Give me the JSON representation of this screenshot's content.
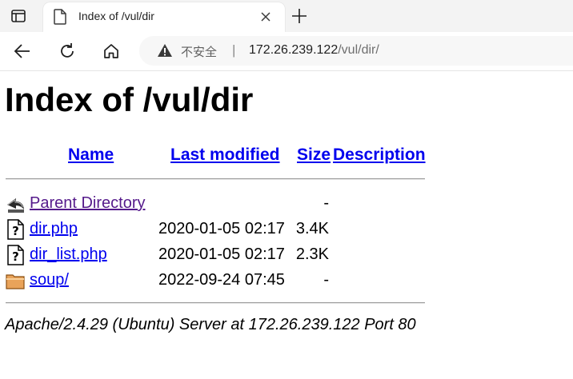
{
  "browser": {
    "tab_title": "Index of /vul/dir",
    "security_label": "不安全",
    "url_host": "172.26.239.122",
    "url_path": "/vul/dir/"
  },
  "page": {
    "heading": "Index of /vul/dir",
    "columns": [
      "Name",
      "Last modified",
      "Size",
      "Description"
    ],
    "entries": [
      {
        "icon": "back-icon",
        "name": "Parent Directory",
        "modified": "",
        "size": "-",
        "description": "",
        "visited": true
      },
      {
        "icon": "unknown-file-icon",
        "name": "dir.php",
        "modified": "2020-01-05 02:17",
        "size": "3.4K",
        "description": "",
        "visited": false
      },
      {
        "icon": "unknown-file-icon",
        "name": "dir_list.php",
        "modified": "2020-01-05 02:17",
        "size": "2.3K",
        "description": "",
        "visited": false
      },
      {
        "icon": "folder-icon",
        "name": "soup/",
        "modified": "2022-09-24 07:45",
        "size": "-",
        "description": "",
        "visited": false
      }
    ],
    "footer": "Apache/2.4.29 (Ubuntu) Server at 172.26.239.122 Port 80"
  },
  "colors": {
    "link": "#0000ee",
    "visited_link": "#551a8b",
    "chrome_bg": "#f3f3f3",
    "address_bg": "#f7f7f7"
  }
}
